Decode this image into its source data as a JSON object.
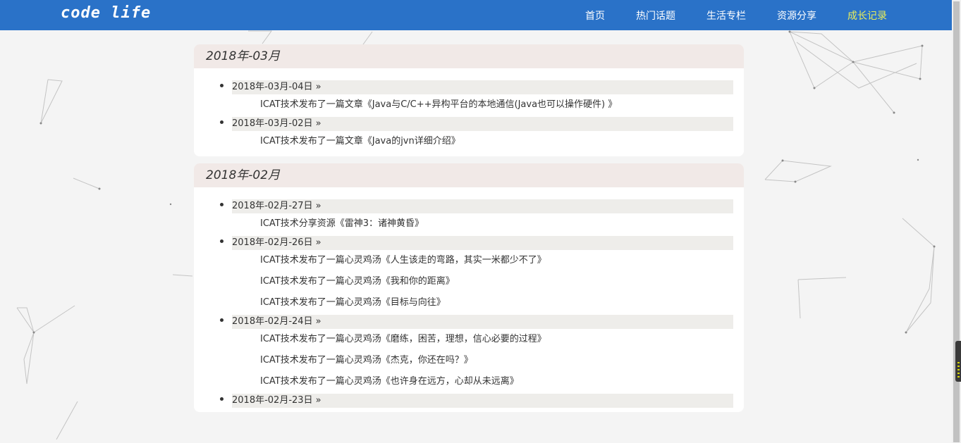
{
  "header": {
    "logo": "code life",
    "nav": [
      {
        "label": "首页",
        "active": false
      },
      {
        "label": "热门话题",
        "active": false
      },
      {
        "label": "生活专栏",
        "active": false
      },
      {
        "label": "资源分享",
        "active": false
      },
      {
        "label": "成长记录",
        "active": true
      }
    ],
    "accent_color": "#2a72c8",
    "active_color": "#e9ee5a"
  },
  "timeline": [
    {
      "month": "2018年-03月",
      "days": [
        {
          "date": "2018年-03月-04日",
          "arrow": "»",
          "entries": [
            "ICAT技术发布了一篇文章《Java与C/C++异构平台的本地通信(Java也可以操作硬件) 》"
          ]
        },
        {
          "date": "2018年-03月-02日",
          "arrow": "»",
          "entries": [
            "ICAT技术发布了一篇文章《Java的jvn详细介绍》"
          ]
        }
      ]
    },
    {
      "month": "2018年-02月",
      "days": [
        {
          "date": "2018年-02月-27日",
          "arrow": "»",
          "entries": [
            "ICAT技术分享资源《雷神3：诸神黄昏》"
          ]
        },
        {
          "date": "2018年-02月-26日",
          "arrow": "»",
          "entries": [
            "ICAT技术发布了一篇心灵鸡汤《人生该走的弯路，其实一米都少不了》",
            "ICAT技术发布了一篇心灵鸡汤《我和你的距离》",
            "ICAT技术发布了一篇心灵鸡汤《目标与向往》"
          ]
        },
        {
          "date": "2018年-02月-24日",
          "arrow": "»",
          "entries": [
            "ICAT技术发布了一篇心灵鸡汤《磨练，困苦，理想，信心必要的过程》",
            "ICAT技术发布了一篇心灵鸡汤《杰克，你还在吗？》",
            "ICAT技术发布了一篇心灵鸡汤《也许身在远方，心却从未远离》"
          ]
        },
        {
          "date": "2018年-02月-23日",
          "arrow": "»",
          "entries": []
        }
      ]
    }
  ]
}
